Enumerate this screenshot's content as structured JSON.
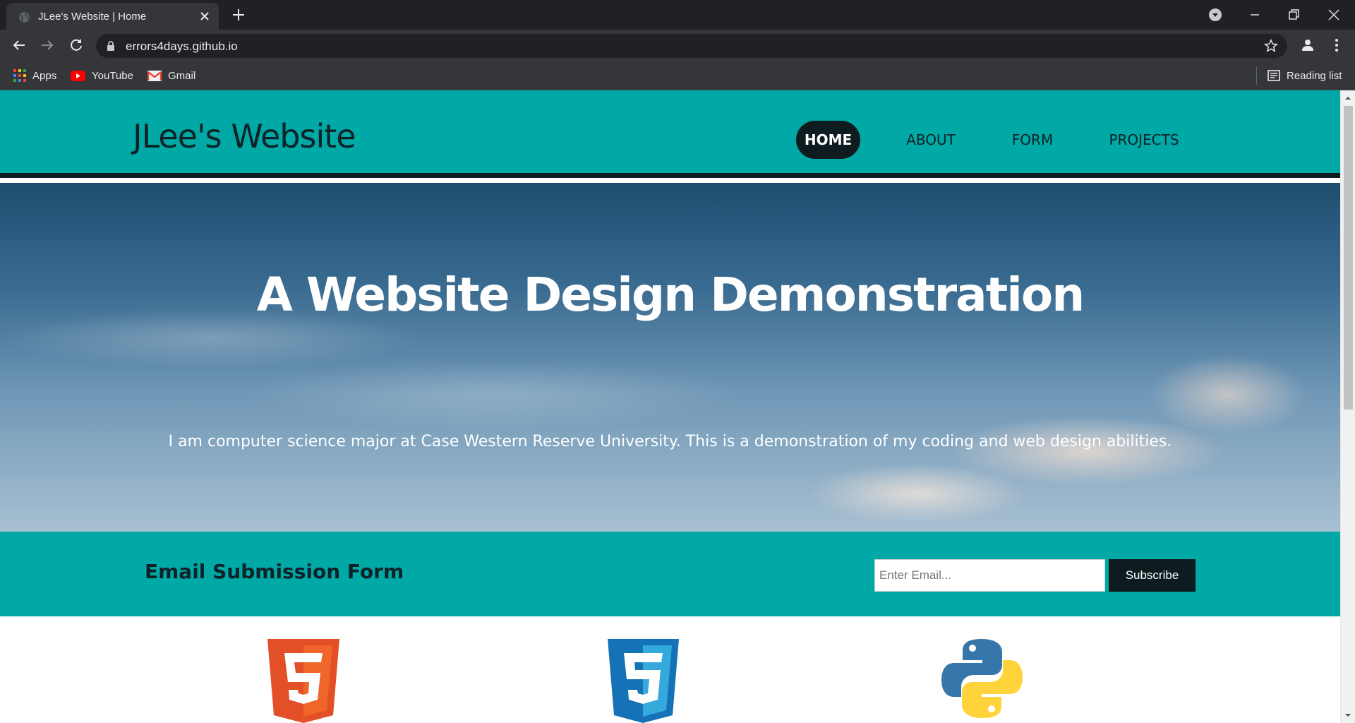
{
  "browser": {
    "tab_title": "JLee's Website | Home",
    "url": "errors4days.github.io",
    "bookmarks": [
      {
        "label": "Apps",
        "icon": "apps-grid-icon"
      },
      {
        "label": "YouTube",
        "icon": "youtube-icon"
      },
      {
        "label": "Gmail",
        "icon": "gmail-icon"
      }
    ],
    "reading_list": "Reading list"
  },
  "site": {
    "logo": "JLee's Website",
    "nav": [
      {
        "label": "HOME",
        "active": true
      },
      {
        "label": "ABOUT",
        "active": false
      },
      {
        "label": "FORM",
        "active": false
      },
      {
        "label": "PROJECTS",
        "active": false
      }
    ],
    "hero": {
      "title": "A Website Design Demonstration",
      "subtitle": "I am computer science major at Case Western Reserve University. This is a demonstration of my coding and web design abilities."
    },
    "email_form": {
      "title": "Email Submission Form",
      "placeholder": "Enter Email...",
      "button": "Subscribe"
    },
    "tech_logos": [
      "html5-icon",
      "css3-icon",
      "python-icon"
    ]
  },
  "colors": {
    "teal": "#00a9a5",
    "dark": "#0e1b1f",
    "chrome_dark": "#202124",
    "chrome_mid": "#35363a"
  }
}
